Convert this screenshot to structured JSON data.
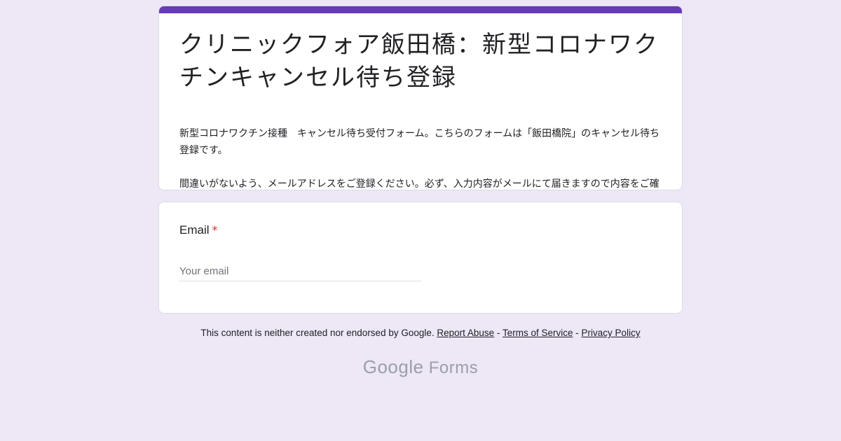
{
  "form": {
    "title": "クリニックフォア飯田橋：新型コロナワクチンキャンセル待ち登録",
    "description_lines": [
      "新型コロナワクチン接種　キャンセル待ち受付フォーム。こちらのフォームは「飯田橋院」のキャンセル待ち登録です。",
      "間違いがないよう、メールアドレスをご登録ください。必ず、入力内容がメールにて届きますので内容をご確認ください。"
    ],
    "accent_color": "#673ab7"
  },
  "question": {
    "label": "Email",
    "required_marker": "*",
    "placeholder": "Your email",
    "value": ""
  },
  "footer": {
    "disclaimer": "This content is neither created nor endorsed by Google.",
    "report_abuse": "Report Abuse",
    "terms": "Terms of Service",
    "privacy": "Privacy Policy",
    "separator": "-"
  },
  "brand": {
    "google": "Google",
    "forms": "Forms"
  }
}
